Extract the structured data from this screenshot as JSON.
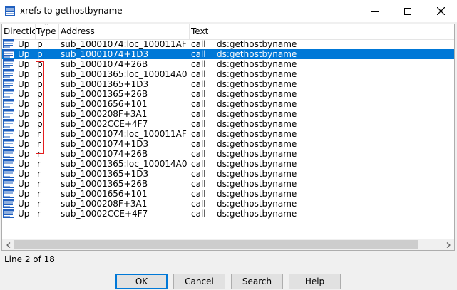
{
  "window": {
    "title": "xrefs to gethostbyname",
    "title_icon": "xref-window-icon",
    "controls": [
      "minimize-icon",
      "maximize-icon",
      "close-icon"
    ]
  },
  "columns": [
    "Directic",
    "Type",
    "Address",
    "Text"
  ],
  "rows": [
    {
      "direction": "Up",
      "type": "p",
      "address": "sub_10001074:loc_100011AF",
      "cmd": "call",
      "target": "ds:gethostbyname",
      "selected": false
    },
    {
      "direction": "Up",
      "type": "p",
      "address": "sub_10001074+1D3",
      "cmd": "call",
      "target": "ds:gethostbyname",
      "selected": true
    },
    {
      "direction": "Up",
      "type": "p",
      "address": "sub_10001074+26B",
      "cmd": "call",
      "target": "ds:gethostbyname",
      "selected": false
    },
    {
      "direction": "Up",
      "type": "p",
      "address": "sub_10001365:loc_100014A0",
      "cmd": "call",
      "target": "ds:gethostbyname",
      "selected": false
    },
    {
      "direction": "Up",
      "type": "p",
      "address": "sub_10001365+1D3",
      "cmd": "call",
      "target": "ds:gethostbyname",
      "selected": false
    },
    {
      "direction": "Up",
      "type": "p",
      "address": "sub_10001365+26B",
      "cmd": "call",
      "target": "ds:gethostbyname",
      "selected": false
    },
    {
      "direction": "Up",
      "type": "p",
      "address": "sub_10001656+101",
      "cmd": "call",
      "target": "ds:gethostbyname",
      "selected": false
    },
    {
      "direction": "Up",
      "type": "p",
      "address": "sub_1000208F+3A1",
      "cmd": "call",
      "target": "ds:gethostbyname",
      "selected": false
    },
    {
      "direction": "Up",
      "type": "p",
      "address": "sub_10002CCE+4F7",
      "cmd": "call",
      "target": "ds:gethostbyname",
      "selected": false
    },
    {
      "direction": "Up",
      "type": "r",
      "address": "sub_10001074:loc_100011AF",
      "cmd": "call",
      "target": "ds:gethostbyname",
      "selected": false
    },
    {
      "direction": "Up",
      "type": "r",
      "address": "sub_10001074+1D3",
      "cmd": "call",
      "target": "ds:gethostbyname",
      "selected": false
    },
    {
      "direction": "Up",
      "type": "r",
      "address": "sub_10001074+26B",
      "cmd": "call",
      "target": "ds:gethostbyname",
      "selected": false
    },
    {
      "direction": "Up",
      "type": "r",
      "address": "sub_10001365:loc_100014A0",
      "cmd": "call",
      "target": "ds:gethostbyname",
      "selected": false
    },
    {
      "direction": "Up",
      "type": "r",
      "address": "sub_10001365+1D3",
      "cmd": "call",
      "target": "ds:gethostbyname",
      "selected": false
    },
    {
      "direction": "Up",
      "type": "r",
      "address": "sub_10001365+26B",
      "cmd": "call",
      "target": "ds:gethostbyname",
      "selected": false
    },
    {
      "direction": "Up",
      "type": "r",
      "address": "sub_10001656+101",
      "cmd": "call",
      "target": "ds:gethostbyname",
      "selected": false
    },
    {
      "direction": "Up",
      "type": "r",
      "address": "sub_1000208F+3A1",
      "cmd": "call",
      "target": "ds:gethostbyname",
      "selected": false
    },
    {
      "direction": "Up",
      "type": "r",
      "address": "sub_10002CCE+4F7",
      "cmd": "call",
      "target": "ds:gethostbyname",
      "selected": false
    }
  ],
  "row_icon": "xref-row-icon",
  "status": "Line 2 of 18",
  "buttons": {
    "ok": "OK",
    "cancel": "Cancel",
    "search": "Search",
    "help": "Help"
  },
  "colors": {
    "selection": "#0078d7",
    "highlight_box": "#e41e1e",
    "default_button_border": "#0078d7"
  }
}
